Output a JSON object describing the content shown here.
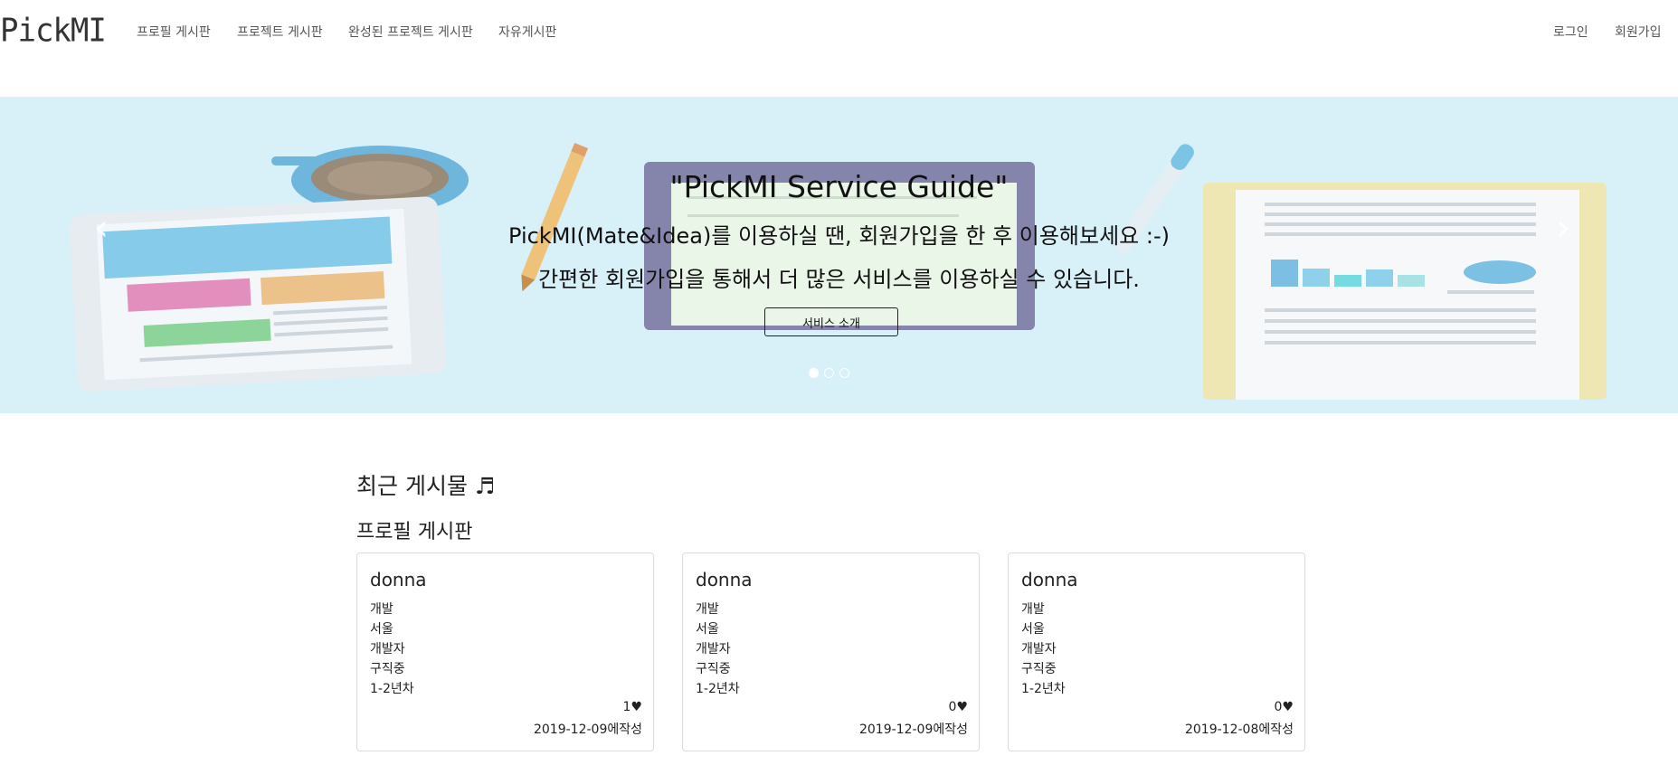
{
  "navbar": {
    "logo": "PickMI",
    "links": [
      "프로필 게시판",
      "프로젝트 게시판",
      "완성된 프로젝트 게시판",
      "자유게시판"
    ],
    "login": "로그인",
    "signup": "회원가입"
  },
  "carousel": {
    "title": "\"PickMI Service Guide\"",
    "line1": "PickMI(Mate&Idea)를 이용하실 땐, 회원가입을 한 후 이용해보세요 :-)",
    "line2": "간편한 회원가입을 통해서 더 많은 서비스를 이용하실 수 있습니다.",
    "button": "서비스 소개",
    "prev_icon": "chevron-left-icon",
    "next_icon": "chevron-right-icon",
    "slide_count": 3,
    "active_slide": 1
  },
  "main": {
    "section_title": "최근 게시물 ♬",
    "board_title": "프로필 게시판",
    "cards": [
      {
        "name": "donna",
        "fields": [
          "개발",
          "서울",
          "개발자",
          "구직중",
          "1-2년차"
        ],
        "likes": "1♥",
        "date": "2019-12-09에작성"
      },
      {
        "name": "donna",
        "fields": [
          "개발",
          "서울",
          "개발자",
          "구직중",
          "1-2년차"
        ],
        "likes": "0♥",
        "date": "2019-12-09에작성"
      },
      {
        "name": "donna",
        "fields": [
          "개발",
          "서울",
          "개발자",
          "구직중",
          "1-2년차"
        ],
        "likes": "0♥",
        "date": "2019-12-08에작성"
      }
    ]
  },
  "colors": {
    "banner_bg": "#d8f0f7",
    "text": "#212529",
    "card_border": "#dcdcdc"
  }
}
